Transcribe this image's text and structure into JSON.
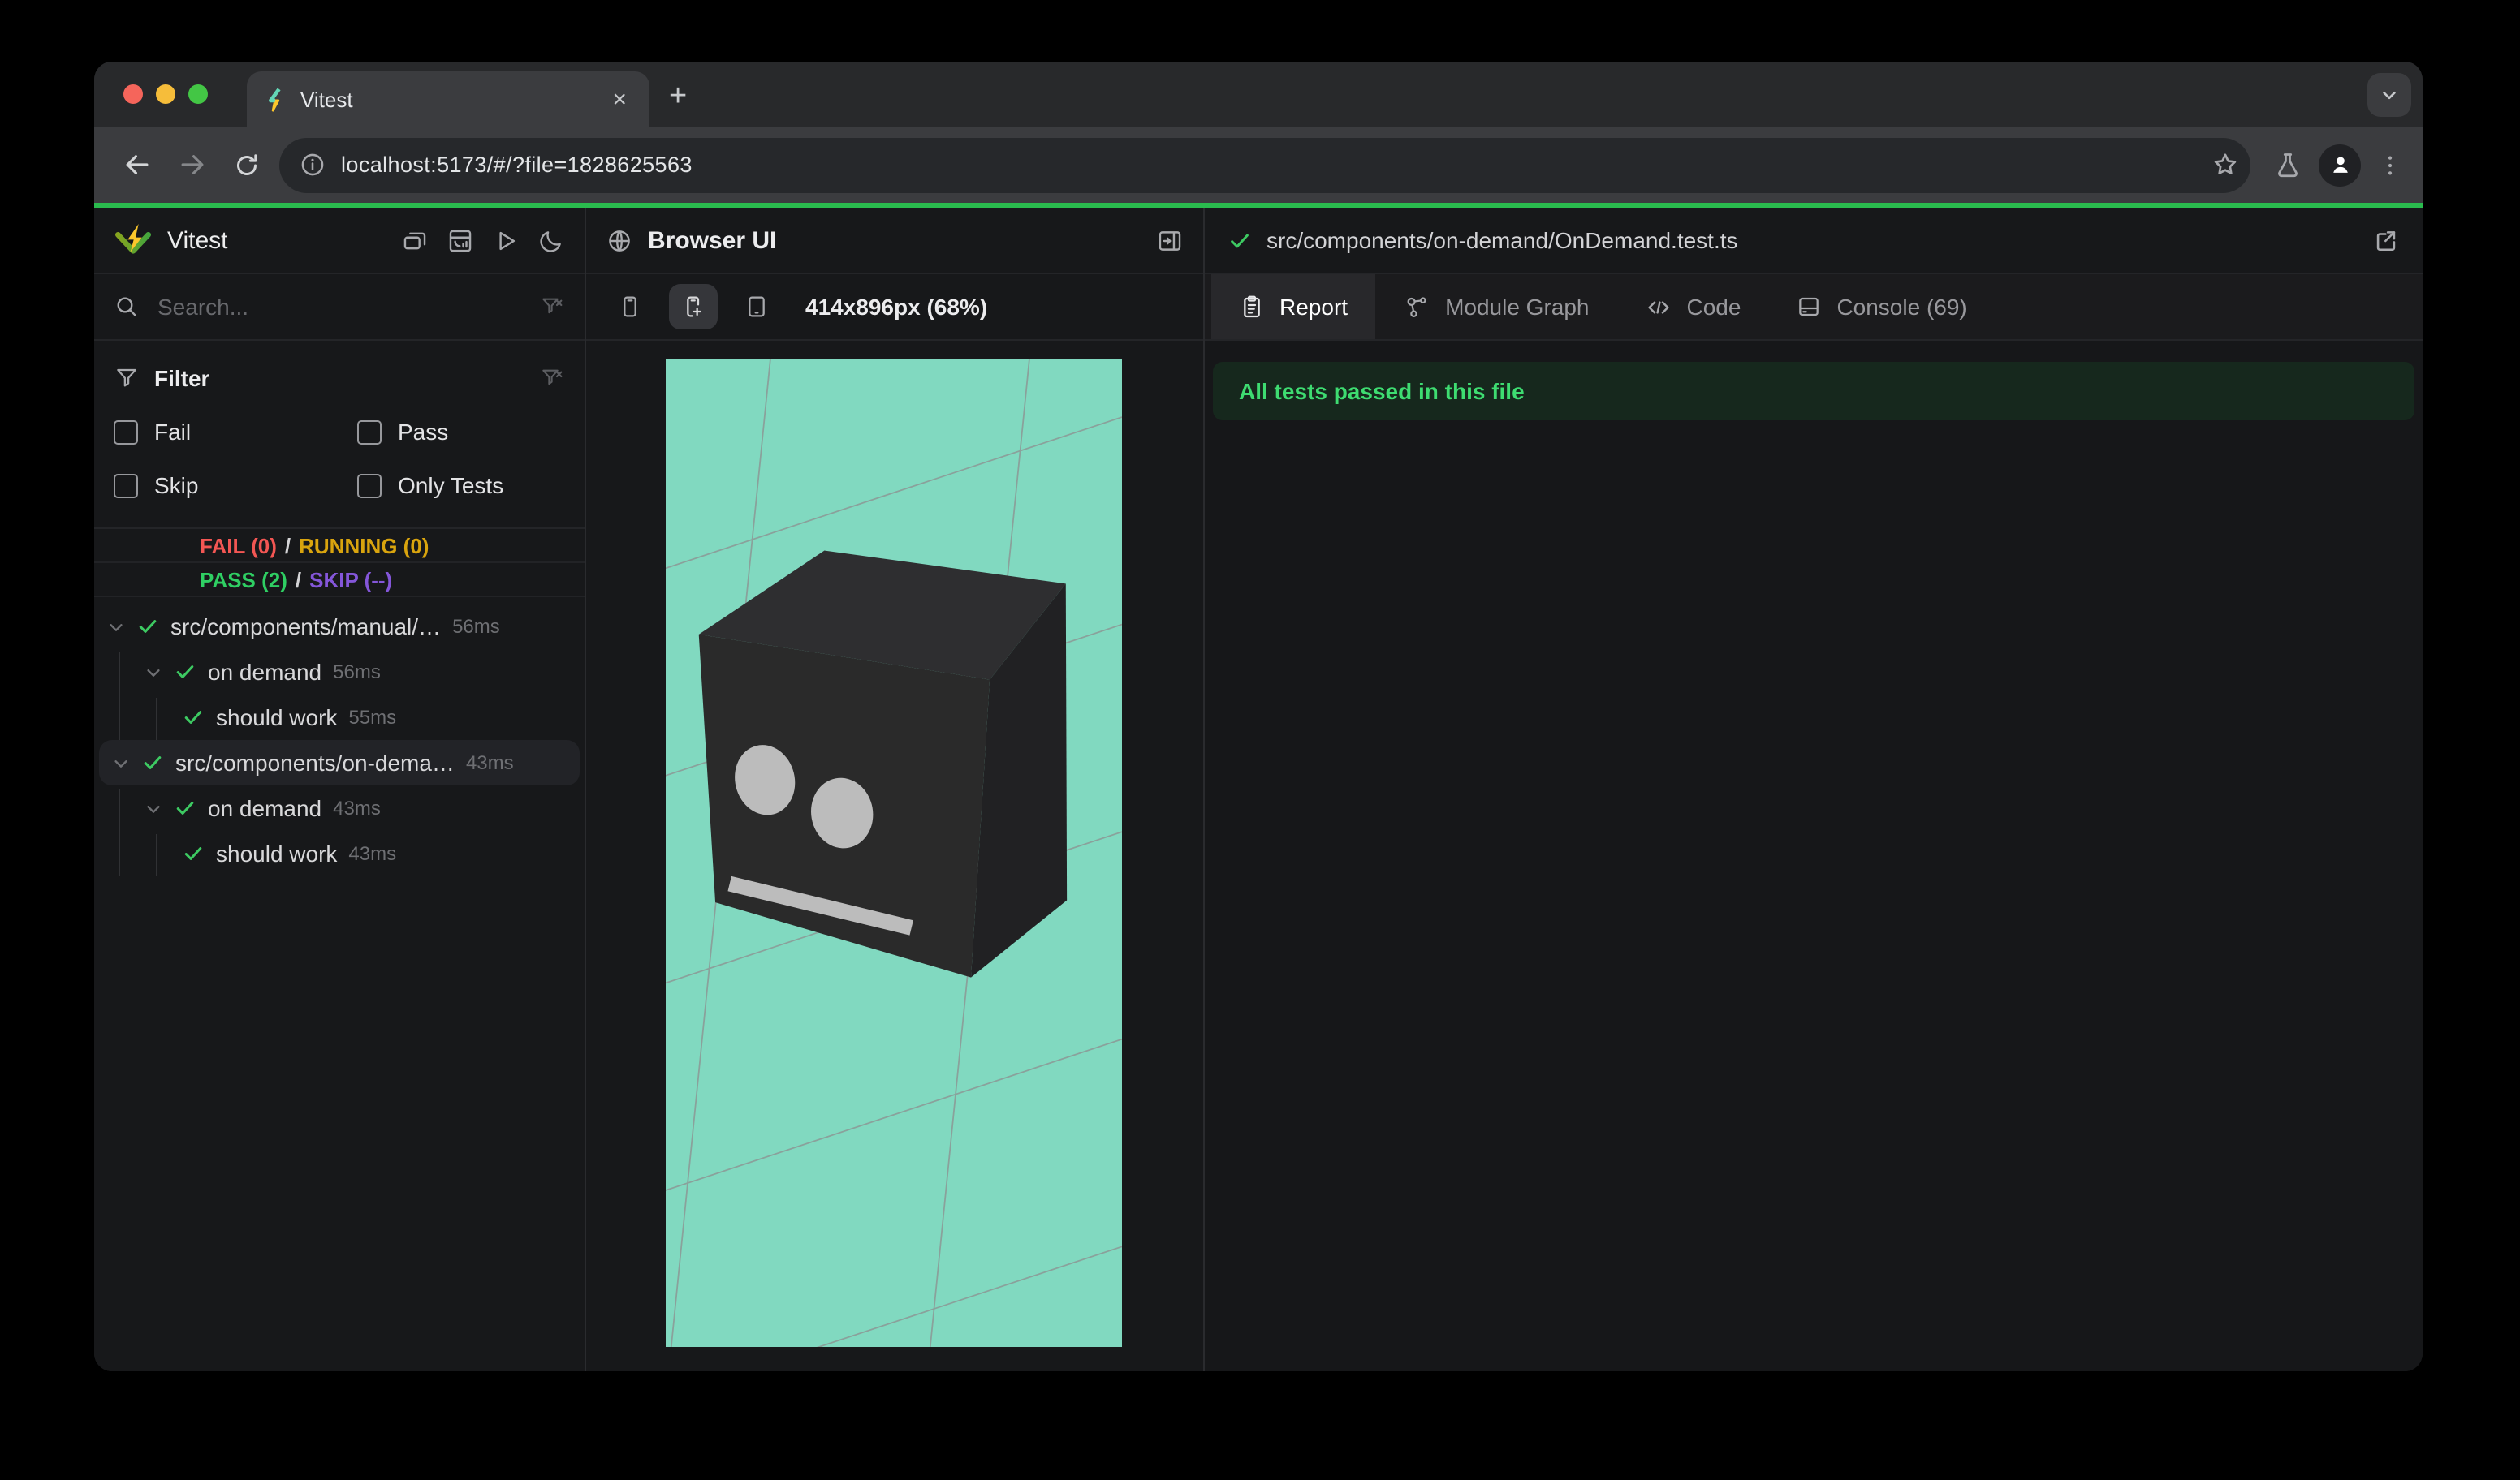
{
  "colors": {
    "progress_green": "#2abb4e",
    "check_green": "#3dca62",
    "fail_red": "#f35653",
    "running_yellow": "#d9a40e",
    "pass_green": "#2fcf63",
    "skip_purple": "#8456d9",
    "banner_bg": "#16281d",
    "banner_text": "#3edc71",
    "mint": "#81d9c0",
    "cube_top": "#2e2e30",
    "cube_front": "#2a2a2a",
    "cube_side": "#212123",
    "cube_face_gray": "#bcbcbc",
    "grid_line": "#8e8a8c",
    "traffic_red": "#f5655b",
    "traffic_yellow": "#f6bd3a",
    "traffic_green": "#43c645",
    "vitest_yellow": "#fcc72b",
    "vitest_green_left": "#86a41f",
    "vitest_green_right": "#44a53d"
  },
  "browser": {
    "tab_title": "Vitest",
    "url": "localhost:5173/#/?file=1828625563",
    "close_glyph": "×",
    "new_tab_glyph": "+"
  },
  "sidebar": {
    "title": "Vitest",
    "search_placeholder": "Search...",
    "filter": {
      "label": "Filter",
      "options": [
        "Fail",
        "Pass",
        "Skip",
        "Only Tests"
      ]
    },
    "stats": {
      "fail": "FAIL (0)",
      "running": "RUNNING (0)",
      "pass": "PASS (2)",
      "skip": "SKIP (--)",
      "separator": "/"
    },
    "tree": [
      {
        "label": "src/components/manual/…",
        "duration": "56ms"
      },
      {
        "label": "on demand",
        "duration": "56ms"
      },
      {
        "label": "should work",
        "duration": "55ms"
      },
      {
        "label": "src/components/on-dema…",
        "duration": "43ms"
      },
      {
        "label": "on demand",
        "duration": "43ms"
      },
      {
        "label": "should work",
        "duration": "43ms"
      }
    ]
  },
  "preview": {
    "title": "Browser UI",
    "size_label": "414x896px (68%)"
  },
  "results": {
    "file_path": "src/components/on-demand/OnDemand.test.ts",
    "tabs": [
      "Report",
      "Module Graph",
      "Code",
      "Console (69)"
    ],
    "banner": "All tests passed in this file"
  }
}
